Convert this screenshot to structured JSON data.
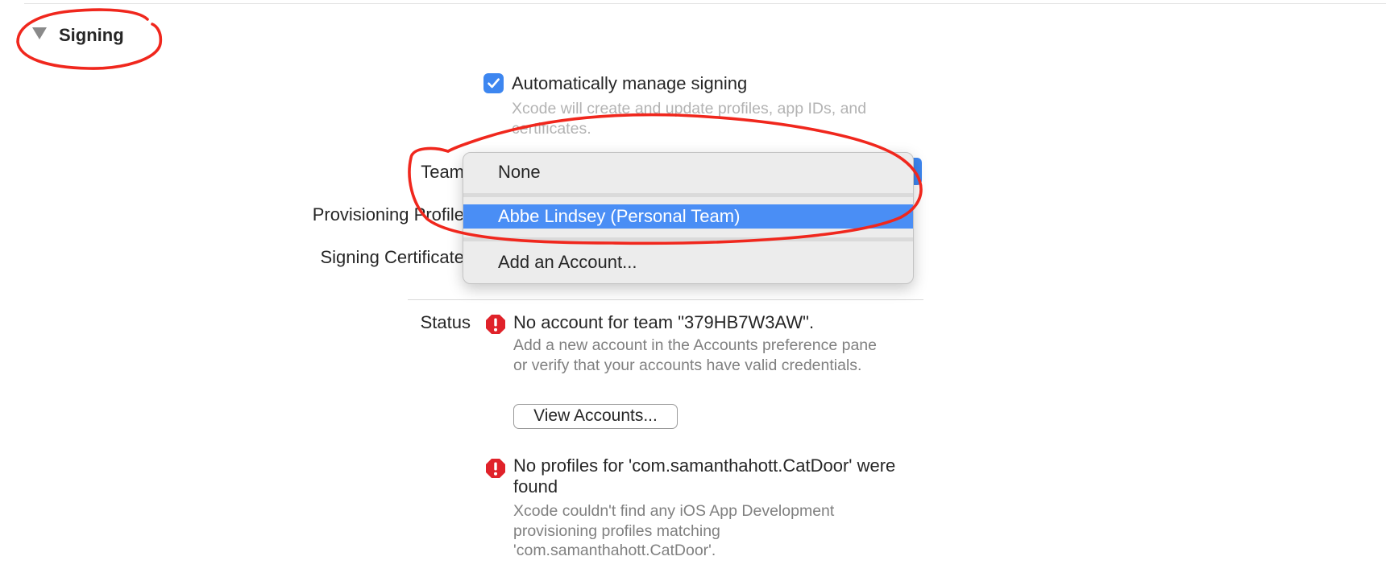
{
  "section": {
    "title": "Signing",
    "disclosure_icon": "disclosure-triangle-down-icon"
  },
  "auto_signing": {
    "label": "Automatically manage signing",
    "checked": true,
    "help": "Xcode will create and update profiles, app IDs, and certificates."
  },
  "fields": {
    "team_label": "Team",
    "profile_label": "Provisioning Profile",
    "certificate_label": "Signing Certificate"
  },
  "team_menu": {
    "items": [
      {
        "label": "None",
        "selected": false
      },
      {
        "label": "Abbe Lindsey (Personal Team)",
        "selected": true
      },
      {
        "label": "Add an Account...",
        "selected": false
      }
    ]
  },
  "status": {
    "label": "Status",
    "errors": [
      {
        "title": "No account for team \"379HB7W3AW\".",
        "body": "Add a new account in the Accounts preference pane or verify that your accounts have valid credentials.",
        "button": "View Accounts..."
      },
      {
        "title": "No profiles for 'com.samanthahott.CatDoor' were found",
        "body": "Xcode couldn't find any iOS App Development provisioning profiles matching 'com.samanthahott.CatDoor'."
      }
    ]
  },
  "colors": {
    "accent": "#3d86f0",
    "menu_selection": "#4a8ef5",
    "error": "#e0222a",
    "annotation": "#f0271d"
  }
}
